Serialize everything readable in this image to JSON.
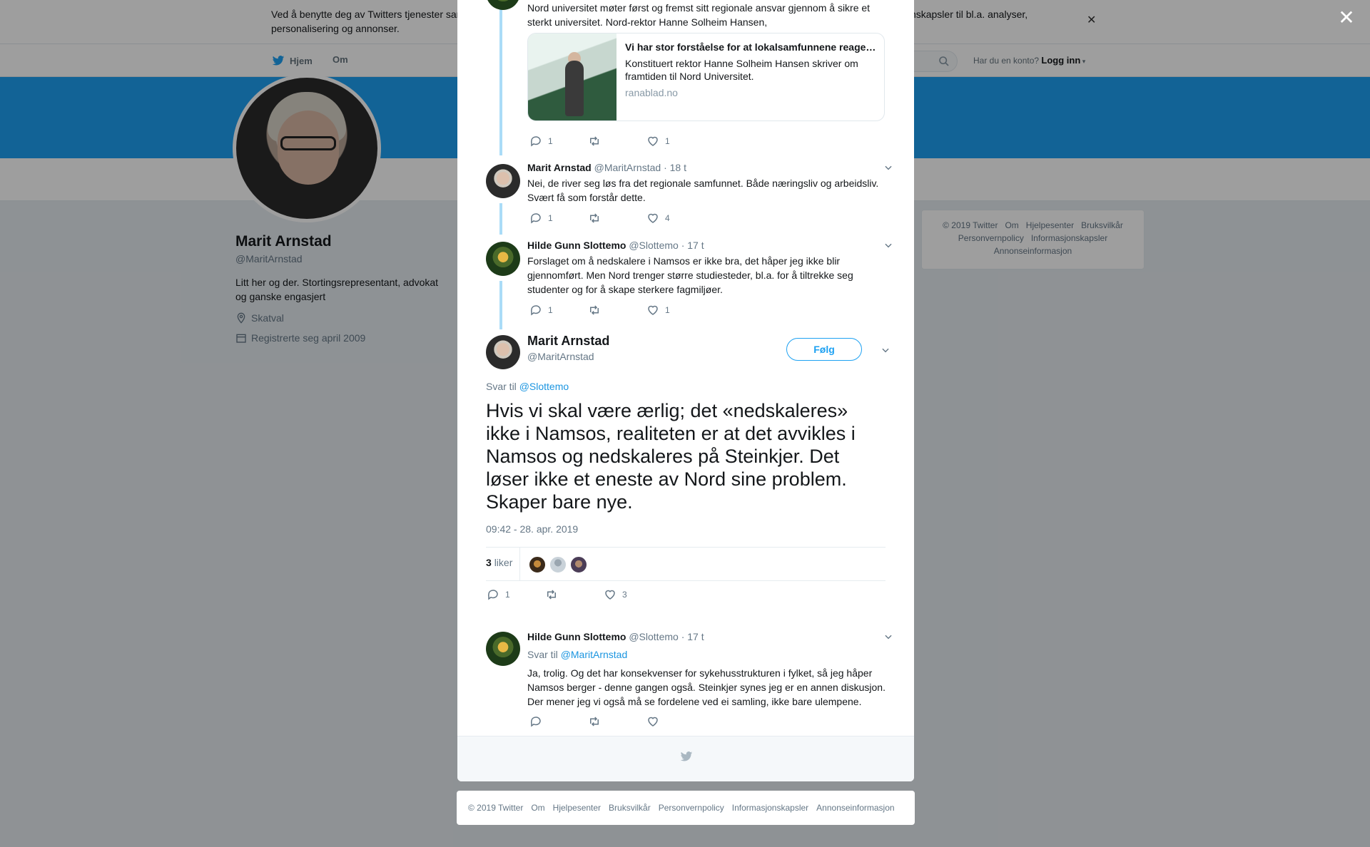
{
  "cookie": {
    "text": "Ved å benytte deg av Twitters tjenester samtykker du i vår bruk av informasjonskapsler. Vi og våre partnere opererer globalt og bruker informasjonskapsler til bl.a. analyser, personalisering og annonser."
  },
  "nav": {
    "home": "Hjem",
    "about": "Om",
    "account_prompt": "Har du en konto?",
    "login": "Logg inn"
  },
  "profile": {
    "name": "Marit Arnstad",
    "handle": "@MaritArnstad",
    "bio": "Litt her og der. Stortingsrepresentant, advokat og ganske engasjert",
    "location": "Skatval",
    "joined": "Registrerte seg april 2009"
  },
  "side_footer": [
    "© 2019 Twitter",
    "Om",
    "Hjelpesenter",
    "Bruksvilkår",
    "Personvernpolicy",
    "Informasjonskapsler",
    "Annonseinformasjon"
  ],
  "thread": {
    "t1": {
      "text": "Nord universitet møter først og fremst sitt regionale ansvar gjennom å sikre et sterkt universitet. Nord-rektor Hanne Solheim Hansen,",
      "card_title": "Vi har stor forståelse for at lokalsamfunnene reagerer",
      "card_desc": "Konstituert rektor Hanne Solheim Hansen skriver om framtiden til Nord Universitet.",
      "card_domain": "ranablad.no",
      "replies": "1",
      "retweets": "",
      "likes": "1"
    },
    "t2": {
      "name": "Marit Arnstad",
      "handle": "@MaritArnstad",
      "time": "· 18 t",
      "text": "Nei, de river seg løs fra det regionale samfunnet. Både næringsliv og arbeidsliv. Svært få som forstår dette.",
      "replies": "1",
      "retweets": "",
      "likes": "4"
    },
    "t3": {
      "name": "Hilde Gunn Slottemo",
      "handle": "@Slottemo",
      "time": "· 17 t",
      "text": "Forslaget om å nedskalere i Namsos er ikke bra, det håper jeg ikke blir gjennomført. Men Nord trenger større studiesteder, bl.a. for å tiltrekke seg studenter og for å skape sterkere fagmiljøer.",
      "replies": "1",
      "retweets": "",
      "likes": "1"
    }
  },
  "focus": {
    "name": "Marit Arnstad",
    "handle": "@MaritArnstad",
    "follow": "Følg",
    "reply_prefix": "Svar til",
    "reply_to": "@Slottemo",
    "text": "Hvis vi skal være ærlig; det «nedskaleres» ikke i Namsos, realiteten er at det avvikles i Namsos og nedskaleres på Steinkjer. Det løser ikke et eneste av Nord sine problem. Skaper bare nye.",
    "time": "09:42 - 28. apr. 2019",
    "likes_count": "3",
    "likes_label": "liker",
    "replies": "1",
    "retweets": "",
    "likes": "3"
  },
  "reply1": {
    "name": "Hilde Gunn Slottemo",
    "handle": "@Slottemo",
    "time": "· 17 t",
    "reply_prefix": "Svar til",
    "reply_to": "@MaritArnstad",
    "text": "Ja, trolig. Og det har konsekvenser for sykehusstrukturen i fylket, så jeg håper Namsos berger - denne gangen også. Steinkjer synes jeg er en annen diskusjon. Der mener jeg vi også må se fordelene ved ei samling, ikke bare ulempene.",
    "replies": "",
    "retweets": "",
    "likes": ""
  },
  "bottom_footer": [
    "© 2019 Twitter",
    "Om",
    "Hjelpesenter",
    "Bruksvilkår",
    "Personvernpolicy",
    "Informasjonskapsler",
    "Annonseinformasjon"
  ],
  "colors": {
    "brand": "#1da1f2",
    "link": "#1b95e0",
    "thread_line": "#aadcf7",
    "muted": "#657786"
  },
  "icons": [
    "twitter-bird-icon",
    "search-icon",
    "location-pin-icon",
    "calendar-icon",
    "reply-icon",
    "retweet-icon",
    "heart-icon",
    "chevron-down-icon",
    "close-icon"
  ]
}
